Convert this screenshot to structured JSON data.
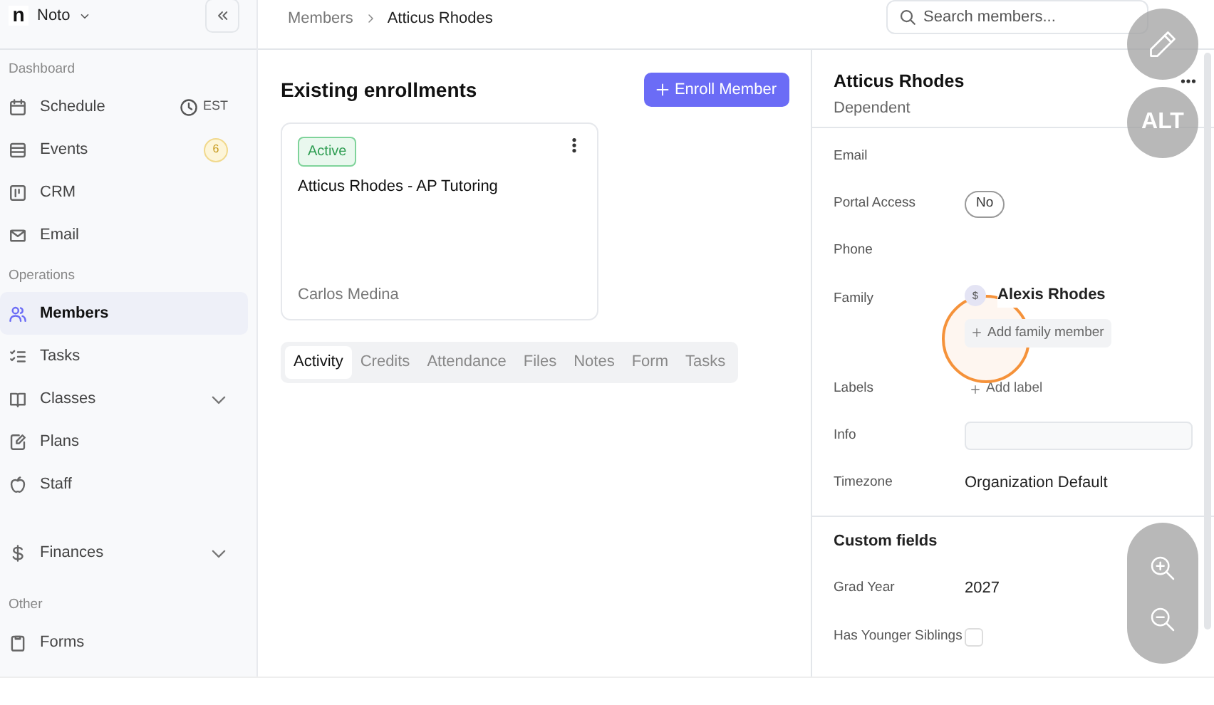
{
  "workspace": {
    "logo": "n",
    "name": "Noto"
  },
  "sidebar": {
    "sections": [
      {
        "label": "Dashboard",
        "items": [
          {
            "label": "Schedule",
            "kind": "link",
            "selected": false,
            "meta": "EST"
          },
          {
            "label": "Events",
            "kind": "link",
            "selected": false,
            "badge": "6"
          },
          {
            "label": "CRM",
            "kind": "link",
            "selected": false
          },
          {
            "label": "Email",
            "kind": "link",
            "selected": false
          }
        ]
      },
      {
        "label": "Operations",
        "items": [
          {
            "label": "Members",
            "kind": "link",
            "selected": true
          },
          {
            "label": "Tasks",
            "kind": "link",
            "selected": false
          },
          {
            "label": "Classes",
            "kind": "group",
            "selected": false,
            "expanded": false
          },
          {
            "label": "Plans",
            "kind": "link",
            "selected": false
          },
          {
            "label": "Staff",
            "kind": "link",
            "selected": false
          }
        ]
      },
      {
        "items": [
          {
            "label": "Finances",
            "kind": "group",
            "selected": false,
            "expanded": false
          }
        ]
      },
      {
        "label": "Other",
        "items": [
          {
            "label": "Forms",
            "kind": "link",
            "selected": false
          }
        ]
      }
    ]
  },
  "breadcrumb": [
    "Members",
    "Atticus Rhodes"
  ],
  "search": {
    "placeholder": "Search members..."
  },
  "enrollments": {
    "title": "Existing enrollments",
    "button": "Enroll Member",
    "cards": [
      {
        "status": "Active",
        "title": "Atticus Rhodes - AP Tutoring",
        "instructor": "Carlos Medina"
      }
    ]
  },
  "tabs": [
    {
      "label": "Activity",
      "selected": true
    },
    {
      "label": "Credits",
      "selected": false
    },
    {
      "label": "Attendance",
      "selected": false
    },
    {
      "label": "Files",
      "selected": false
    },
    {
      "label": "Notes",
      "selected": false
    },
    {
      "label": "Form",
      "selected": false
    },
    {
      "label": "Tasks",
      "selected": false
    }
  ],
  "profile": {
    "name": "Atticus Rhodes",
    "role": "Dependent",
    "fields": [
      {
        "label": "Email",
        "kind": "empty"
      },
      {
        "label": "Portal Access",
        "kind": "pill",
        "value": "No"
      },
      {
        "label": "Phone",
        "kind": "empty"
      },
      {
        "label": "Family",
        "kind": "family",
        "avatar": "$",
        "value": "Alexis Rhodes",
        "action": "Add family member"
      },
      {
        "label": "Labels",
        "kind": "add",
        "action": "Add label"
      },
      {
        "label": "Info",
        "kind": "input"
      },
      {
        "label": "Timezone",
        "kind": "text",
        "value": "Organization Default"
      }
    ]
  },
  "custom_fields": {
    "title": "Custom fields",
    "fields": [
      {
        "label": "Grad Year",
        "kind": "text",
        "value": "2027"
      },
      {
        "label": "Has Younger Siblings",
        "kind": "checkbox",
        "checked": false
      }
    ]
  },
  "overlay": {
    "alt_label": "ALT"
  }
}
